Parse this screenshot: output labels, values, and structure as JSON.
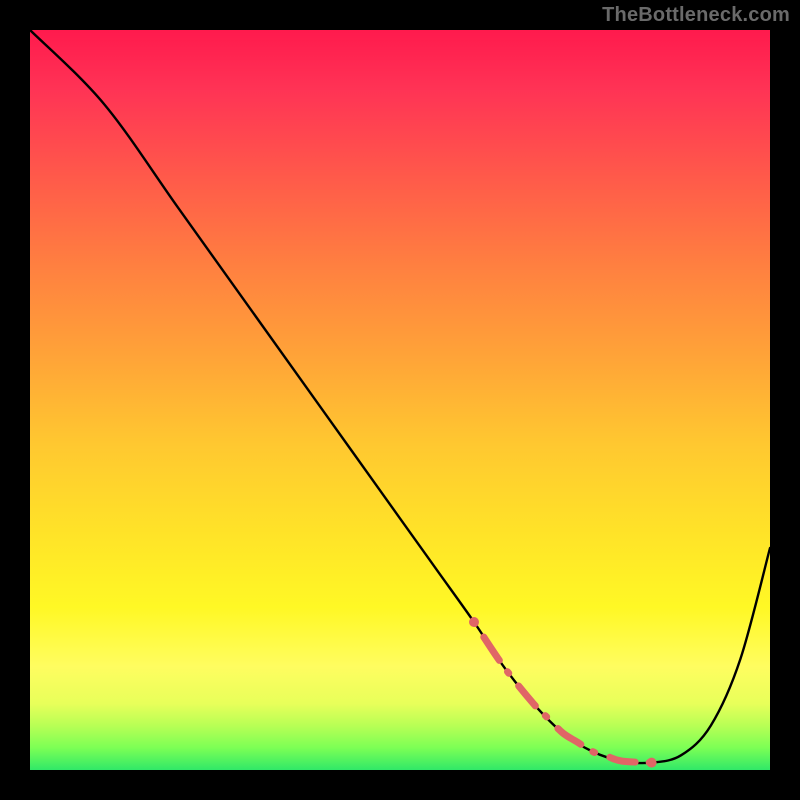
{
  "watermark": "TheBottleneck.com",
  "chart_data": {
    "type": "line",
    "title": "",
    "xlabel": "",
    "ylabel": "",
    "xlim": [
      0,
      100
    ],
    "ylim": [
      0,
      100
    ],
    "series": [
      {
        "name": "curve",
        "x": [
          0,
          10,
          20,
          30,
          40,
          50,
          55,
          60,
          64,
          68,
          72,
          76,
          80,
          84,
          88,
          92,
          96,
          100
        ],
        "y": [
          100,
          90,
          76,
          62,
          48,
          34,
          27,
          20,
          14,
          9,
          5,
          2.5,
          1.2,
          1.0,
          2.0,
          6,
          15,
          30
        ]
      }
    ],
    "trough_markers": {
      "color": "#e06666",
      "points_x": [
        60,
        64,
        68,
        70,
        72,
        74,
        76,
        78,
        80,
        84
      ]
    },
    "colors": {
      "gradient_top": "#ff1a4d",
      "gradient_bottom": "#30e868",
      "curve": "#000000",
      "markers": "#e06666",
      "background": "#000000"
    }
  }
}
